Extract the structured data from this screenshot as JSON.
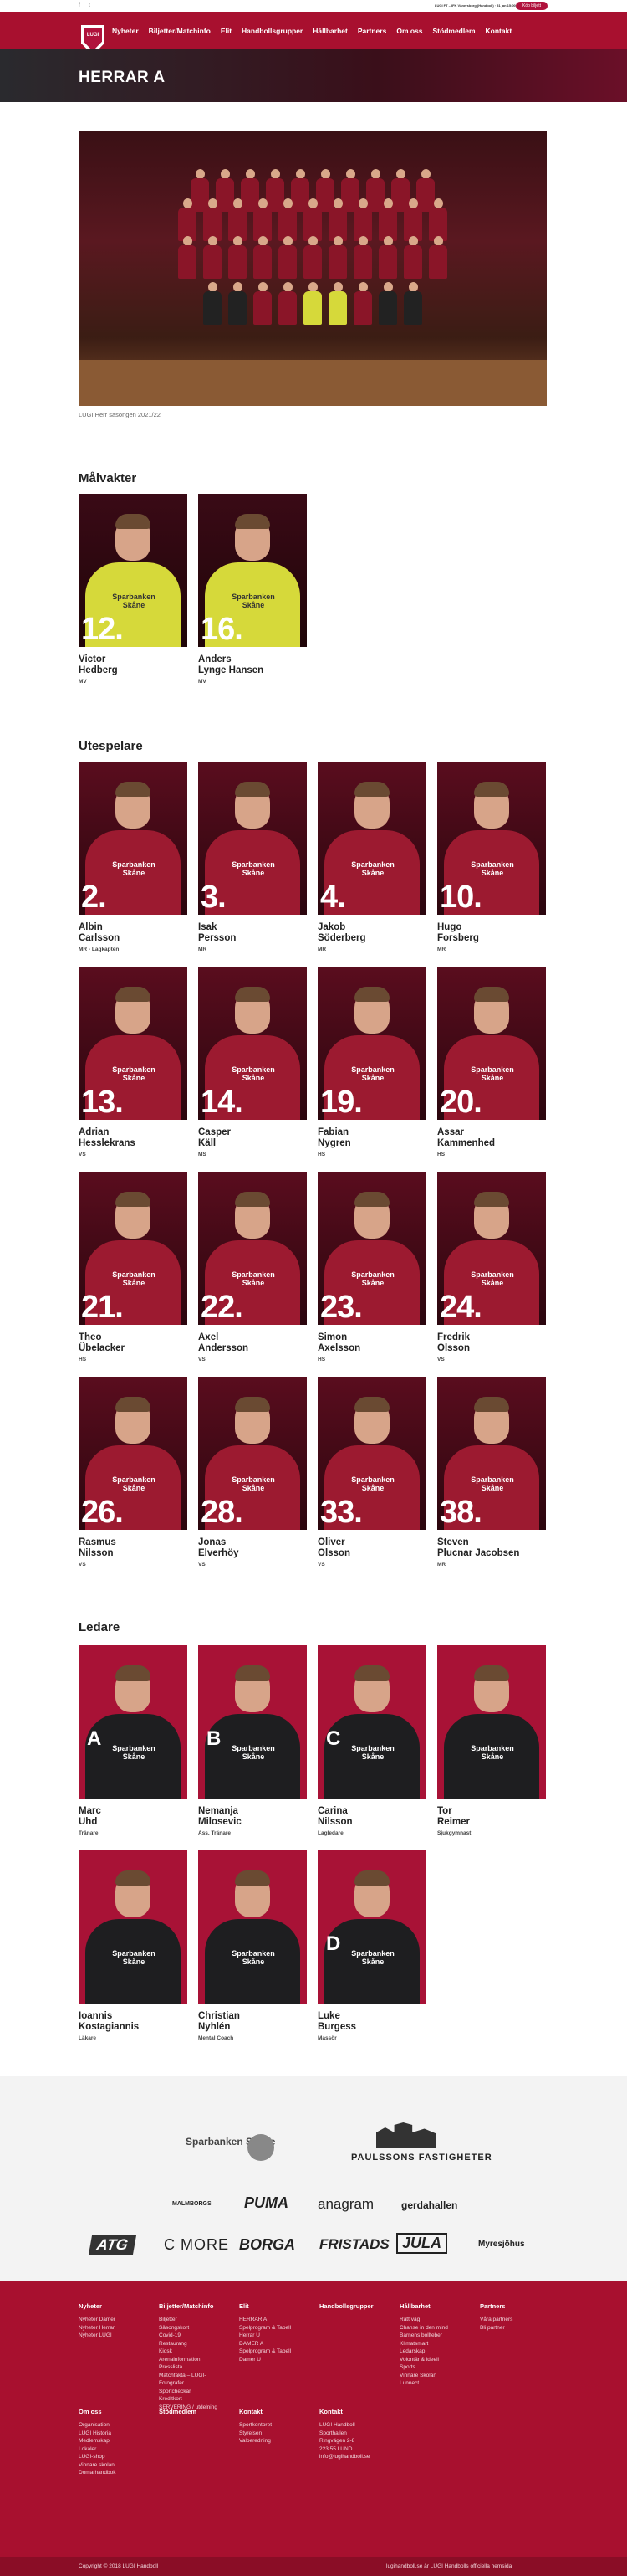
{
  "topbar": {
    "social_icons": [
      "facebook-icon",
      "twitter-icon"
    ],
    "live_text": "LUGI FT – IFK Vänersborg (Handboll) · 31 jan 15:00",
    "cta_label": "Köp biljett"
  },
  "nav": {
    "logo_text": "LUGI",
    "items": [
      "Nyheter",
      "Biljetter/Matchinfo",
      "Elit",
      "Handbollsgrupper",
      "Hållbarhet",
      "Partners",
      "Om oss",
      "Stödmedlem",
      "Kontakt"
    ]
  },
  "page": {
    "title": "HERRAR A",
    "team_caption": "LUGI Herr säsongen 2021/22"
  },
  "sections": {
    "goalkeepers": "Målvakter",
    "outfield": "Utespelare",
    "staff": "Ledare"
  },
  "goalkeepers": [
    {
      "number": "12.",
      "name_first": "Victor",
      "name_last": "Hedberg",
      "position": "MV"
    },
    {
      "number": "16.",
      "name_first": "Anders",
      "name_last": "Lynge Hansen",
      "position": "MV"
    }
  ],
  "outfield": [
    {
      "number": "2.",
      "name_first": "Albin",
      "name_last": "Carlsson",
      "position": "MR - Lagkapten"
    },
    {
      "number": "3.",
      "name_first": "Isak",
      "name_last": "Persson",
      "position": "MR"
    },
    {
      "number": "4.",
      "name_first": "Jakob",
      "name_last": "Söderberg",
      "position": "MR"
    },
    {
      "number": "10.",
      "name_first": "Hugo",
      "name_last": "Forsberg",
      "position": "MR"
    },
    {
      "number": "13.",
      "name_first": "Adrian",
      "name_last": "Hesslekrans",
      "position": "VS"
    },
    {
      "number": "14.",
      "name_first": "Casper",
      "name_last": "Käll",
      "position": "MS"
    },
    {
      "number": "19.",
      "name_first": "Fabian",
      "name_last": "Nygren",
      "position": "HS"
    },
    {
      "number": "20.",
      "name_first": "Assar",
      "name_last": "Kammenhed",
      "position": "HS"
    },
    {
      "number": "21.",
      "name_first": "Theo",
      "name_last": "Übelacker",
      "position": "HS"
    },
    {
      "number": "22.",
      "name_first": "Axel",
      "name_last": "Andersson",
      "position": "VS"
    },
    {
      "number": "23.",
      "name_first": "Simon",
      "name_last": "Axelsson",
      "position": "HS"
    },
    {
      "number": "24.",
      "name_first": "Fredrik",
      "name_last": "Olsson",
      "position": "VS"
    },
    {
      "number": "26.",
      "name_first": "Rasmus",
      "name_last": "Nilsson",
      "position": "VS"
    },
    {
      "number": "28.",
      "name_first": "Jonas",
      "name_last": "Elverhöy",
      "position": "VS"
    },
    {
      "number": "33.",
      "name_first": "Oliver",
      "name_last": "Olsson",
      "position": "VS"
    },
    {
      "number": "38.",
      "name_first": "Steven",
      "name_last": "Plucnar Jacobsen",
      "position": "MR"
    }
  ],
  "staff": [
    {
      "letter": "A",
      "name_first": "Marc",
      "name_last": "Uhd",
      "role": "Tränare"
    },
    {
      "letter": "B",
      "name_first": "Nemanja",
      "name_last": "Milosevic",
      "role": "Ass. Tränare"
    },
    {
      "letter": "C",
      "name_first": "Carina",
      "name_last": "Nilsson",
      "role": "Lagledare"
    },
    {
      "letter": "",
      "name_first": "Tor",
      "name_last": "Reimer",
      "role": "Sjukgymnast"
    },
    {
      "letter": "",
      "name_first": "Ioannis",
      "name_last": "Kostagiannis",
      "role": "Läkare"
    },
    {
      "letter": "",
      "name_first": "Christian",
      "name_last": "Nyhlén",
      "role": "Mental Coach"
    },
    {
      "letter": "D",
      "name_first": "Luke",
      "name_last": "Burgess",
      "role": "Massör"
    }
  ],
  "jersey_sponsor": "Sparbanken Skåne",
  "sponsors": {
    "main": [
      "Sparbanken Skåne",
      "PAULSSONS FASTIGHETER"
    ],
    "row2": [
      "MALMBORGS",
      "PUMA",
      "anagram",
      "gerdahallen"
    ],
    "row3": [
      "ATG",
      "C MORE",
      "BORGA",
      "FRISTADS",
      "JULA",
      "Myresjöhus"
    ]
  },
  "footer": {
    "columns": [
      {
        "title": "Nyheter",
        "items": [
          "Nyheter Damer",
          "Nyheter Herrar",
          "Nyheter LUGI"
        ]
      },
      {
        "title": "Biljetter/Matchinfo",
        "items": [
          "Biljetter",
          "Säsongskort",
          "Covid-19",
          "Restaurang",
          "Kiosk",
          "Arenainformation",
          "Presslista",
          "Matchfakta – LUGI-",
          "Fotografer",
          "Sportcheckar",
          "Kreditkort",
          "SERVERING / utdelning"
        ]
      },
      {
        "title": "Elit",
        "items": [
          "HERRAR A",
          "Spelprogram & Tabell",
          "Herrar U",
          "DAMER A",
          "Spelprogram & Tabell",
          "Damer U"
        ]
      },
      {
        "title": "Handbollsgrupper",
        "items": []
      },
      {
        "title": "Hållbarhet",
        "items": [
          "Rätt väg",
          "Chanse in den mind",
          "Barnens bollfeber",
          "Klimatsmart",
          "Ledarskap",
          "Volontär & ideell",
          "Sports",
          "Vinnare Skolan",
          "Lunnect"
        ]
      },
      {
        "title": "Partners",
        "items": [
          "Våra partners",
          "Bli partner"
        ]
      }
    ],
    "columns2": [
      {
        "title": "Om oss",
        "items": [
          "Organisation",
          "LUGI Historia",
          "Medlemskap",
          "Lokaler",
          "LUGI-shop",
          "Vinnare skolan",
          "Domarhandbok"
        ]
      },
      {
        "title": "Stödmedlem",
        "items": []
      },
      {
        "title": "Kontakt",
        "items": [
          "Sportkontoret",
          "Styrelsen",
          "Valberedning"
        ]
      },
      {
        "title": "Kontakt",
        "items": [
          "LUGI Handboll",
          "Sporthallen",
          "Ringvägen 2-8",
          "223 55 LUND",
          "info@lugihandboll.se"
        ]
      }
    ],
    "copyright": "Copyright © 2018 LUGI Handboll",
    "credit": "lugihandboll.se är LUGI Handbolls officiella hemsida"
  }
}
